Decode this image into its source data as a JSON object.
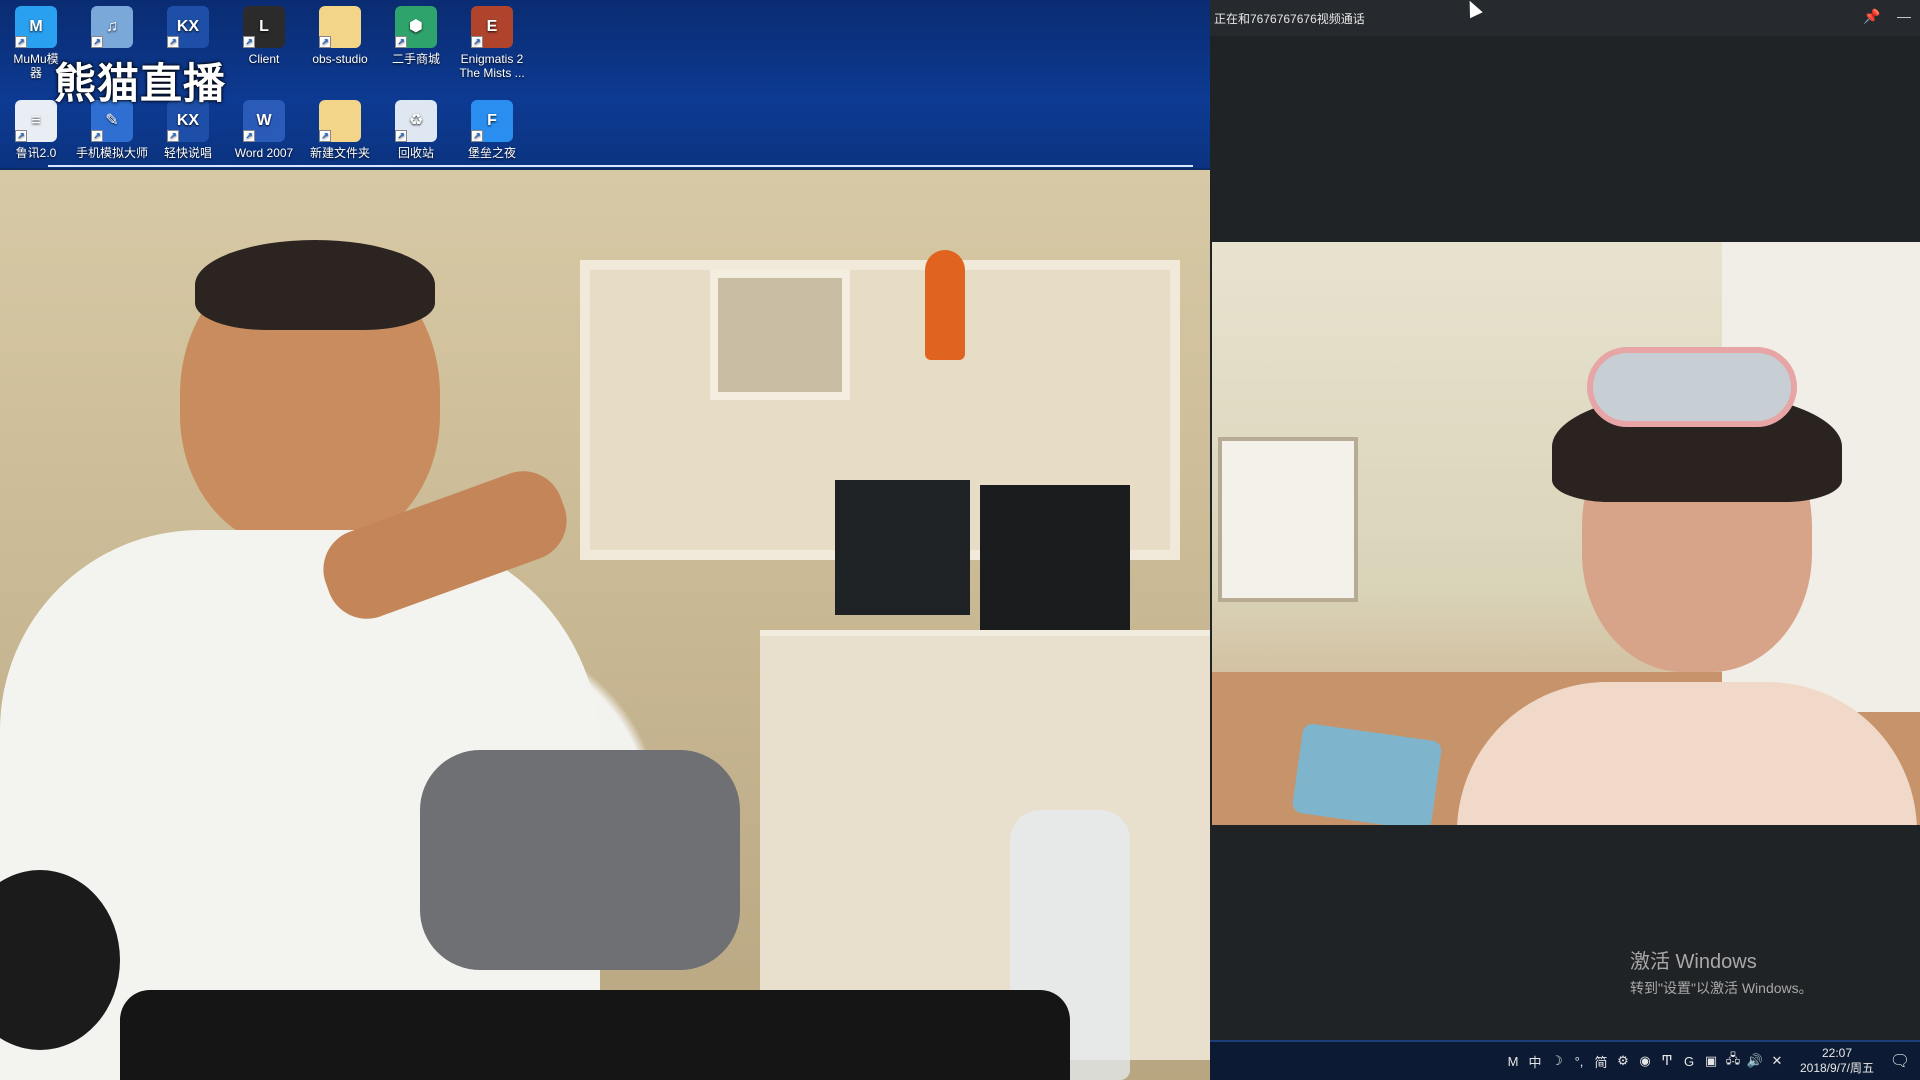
{
  "desktop": {
    "icons": [
      {
        "name": "mumu-icon",
        "label": "MuMu模\n器",
        "glyph": "M",
        "color": "#2aa0f0"
      },
      {
        "name": "mp3-icon",
        "label": "",
        "glyph": "♫",
        "color": "#7aa8d8"
      },
      {
        "name": "kx-icon-1",
        "label": "",
        "glyph": "KX",
        "color": "#1e4fa8"
      },
      {
        "name": "client-icon",
        "label": "Client",
        "glyph": "L",
        "color": "#2b2b2b"
      },
      {
        "name": "obs-studio-icon",
        "label": "obs-studio",
        "glyph": "",
        "color": "#f3d58a"
      },
      {
        "name": "second-hand-mall-icon",
        "label": "二手商城",
        "glyph": "⬢",
        "color": "#2ea36b"
      },
      {
        "name": "enigmatis-icon",
        "label": "Enigmatis 2\nThe Mists ...",
        "glyph": "E",
        "color": "#b0432c"
      },
      {
        "name": "luxun-icon",
        "label": "鲁讯2.0",
        "glyph": "≡",
        "color": "#e9eef5"
      },
      {
        "name": "phone-emulator-icon",
        "label": "手机模拟大师",
        "glyph": "✎",
        "color": "#2e6fd1"
      },
      {
        "name": "kx-icon-2",
        "label": "轻快说唱",
        "glyph": "KX",
        "color": "#1e4fa8"
      },
      {
        "name": "word-2007-icon",
        "label": "Word 2007",
        "glyph": "W",
        "color": "#2b5bb8"
      },
      {
        "name": "new-folder-icon",
        "label": "新建文件夹",
        "glyph": "",
        "color": "#f3d58a"
      },
      {
        "name": "recycle-bin-icon",
        "label": "回收站",
        "glyph": "♻",
        "color": "#dfe8f2"
      },
      {
        "name": "fortress-night-icon",
        "label": "堡垒之夜",
        "glyph": "F",
        "color": "#2a8ef0"
      }
    ],
    "watermark": "熊猫直播"
  },
  "call_window": {
    "title": "正在和7676767676视频通话",
    "pin_label": "📌",
    "minimize_label": "—"
  },
  "system": {
    "activation_title": "激活 Windows",
    "activation_sub": "转到\"设置\"以激活 Windows。",
    "time": "22:07",
    "date": "2018/9/7/周五",
    "tray": [
      {
        "name": "tray-m-icon",
        "glyph": "M"
      },
      {
        "name": "tray-ime-zh-icon",
        "glyph": "中"
      },
      {
        "name": "tray-moon-icon",
        "glyph": "☽"
      },
      {
        "name": "tray-punct-icon",
        "glyph": "°,"
      },
      {
        "name": "tray-simplified-icon",
        "glyph": "简"
      },
      {
        "name": "tray-settings-icon",
        "glyph": "⚙"
      },
      {
        "name": "tray-app-icon-1",
        "glyph": "◉"
      },
      {
        "name": "tray-app-icon-2",
        "glyph": "Ͳ"
      },
      {
        "name": "tray-app-icon-3",
        "glyph": "G"
      },
      {
        "name": "tray-app-icon-4",
        "glyph": "▣"
      },
      {
        "name": "tray-network-icon",
        "glyph": "🖧"
      },
      {
        "name": "tray-volume-icon",
        "glyph": "🔊"
      },
      {
        "name": "tray-app-icon-5",
        "glyph": "✕"
      }
    ],
    "notification_glyph": "🗨"
  }
}
